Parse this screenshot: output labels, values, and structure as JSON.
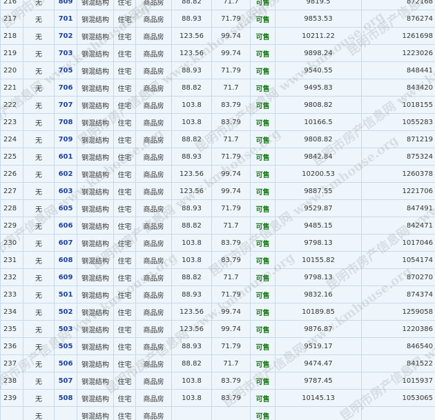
{
  "watermark_text": "昆明市房产信息网 www.kmhouse.org",
  "rows": [
    {
      "seq": "216",
      "mortgage": "无",
      "room": "809",
      "structure": "钢混结构",
      "usage": "住宅",
      "type": "商品房",
      "build_area": "88.82",
      "inner_area": "71.7",
      "status": "可售",
      "unit_price": "9819.5",
      "total_price": "872168"
    },
    {
      "seq": "217",
      "mortgage": "无",
      "room": "701",
      "structure": "钢混结构",
      "usage": "住宅",
      "type": "商品房",
      "build_area": "88.93",
      "inner_area": "71.79",
      "status": "可售",
      "unit_price": "9853.53",
      "total_price": "876274"
    },
    {
      "seq": "218",
      "mortgage": "无",
      "room": "702",
      "structure": "钢混结构",
      "usage": "住宅",
      "type": "商品房",
      "build_area": "123.56",
      "inner_area": "99.74",
      "status": "可售",
      "unit_price": "10211.22",
      "total_price": "1261698"
    },
    {
      "seq": "219",
      "mortgage": "无",
      "room": "703",
      "structure": "钢混结构",
      "usage": "住宅",
      "type": "商品房",
      "build_area": "123.56",
      "inner_area": "99.74",
      "status": "可售",
      "unit_price": "9898.24",
      "total_price": "1223026"
    },
    {
      "seq": "220",
      "mortgage": "无",
      "room": "705",
      "structure": "钢混结构",
      "usage": "住宅",
      "type": "商品房",
      "build_area": "88.93",
      "inner_area": "71.79",
      "status": "可售",
      "unit_price": "9540.55",
      "total_price": "848441"
    },
    {
      "seq": "221",
      "mortgage": "无",
      "room": "706",
      "structure": "钢混结构",
      "usage": "住宅",
      "type": "商品房",
      "build_area": "88.82",
      "inner_area": "71.7",
      "status": "可售",
      "unit_price": "9495.83",
      "total_price": "843420"
    },
    {
      "seq": "222",
      "mortgage": "无",
      "room": "707",
      "structure": "钢混结构",
      "usage": "住宅",
      "type": "商品房",
      "build_area": "103.8",
      "inner_area": "83.79",
      "status": "可售",
      "unit_price": "9808.82",
      "total_price": "1018155"
    },
    {
      "seq": "223",
      "mortgage": "无",
      "room": "708",
      "structure": "钢混结构",
      "usage": "住宅",
      "type": "商品房",
      "build_area": "103.8",
      "inner_area": "83.79",
      "status": "可售",
      "unit_price": "10166.5",
      "total_price": "1055283"
    },
    {
      "seq": "224",
      "mortgage": "无",
      "room": "709",
      "structure": "钢混结构",
      "usage": "住宅",
      "type": "商品房",
      "build_area": "88.82",
      "inner_area": "71.7",
      "status": "可售",
      "unit_price": "9808.82",
      "total_price": "871219"
    },
    {
      "seq": "225",
      "mortgage": "无",
      "room": "601",
      "structure": "钢混结构",
      "usage": "住宅",
      "type": "商品房",
      "build_area": "88.93",
      "inner_area": "71.79",
      "status": "可售",
      "unit_price": "9842.84",
      "total_price": "875324"
    },
    {
      "seq": "226",
      "mortgage": "无",
      "room": "602",
      "structure": "钢混结构",
      "usage": "住宅",
      "type": "商品房",
      "build_area": "123.56",
      "inner_area": "99.74",
      "status": "可售",
      "unit_price": "10200.53",
      "total_price": "1260378"
    },
    {
      "seq": "227",
      "mortgage": "无",
      "room": "603",
      "structure": "钢混结构",
      "usage": "住宅",
      "type": "商品房",
      "build_area": "123.56",
      "inner_area": "99.74",
      "status": "可售",
      "unit_price": "9887.55",
      "total_price": "1221706"
    },
    {
      "seq": "228",
      "mortgage": "无",
      "room": "605",
      "structure": "钢混结构",
      "usage": "住宅",
      "type": "商品房",
      "build_area": "88.93",
      "inner_area": "71.79",
      "status": "可售",
      "unit_price": "9529.87",
      "total_price": "847491"
    },
    {
      "seq": "229",
      "mortgage": "无",
      "room": "606",
      "structure": "钢混结构",
      "usage": "住宅",
      "type": "商品房",
      "build_area": "88.82",
      "inner_area": "71.7",
      "status": "可售",
      "unit_price": "9485.15",
      "total_price": "842471"
    },
    {
      "seq": "230",
      "mortgage": "无",
      "room": "607",
      "structure": "钢混结构",
      "usage": "住宅",
      "type": "商品房",
      "build_area": "103.8",
      "inner_area": "83.79",
      "status": "可售",
      "unit_price": "9798.13",
      "total_price": "1017046"
    },
    {
      "seq": "231",
      "mortgage": "无",
      "room": "608",
      "structure": "钢混结构",
      "usage": "住宅",
      "type": "商品房",
      "build_area": "103.8",
      "inner_area": "83.79",
      "status": "可售",
      "unit_price": "10155.82",
      "total_price": "1054174"
    },
    {
      "seq": "232",
      "mortgage": "无",
      "room": "609",
      "structure": "钢混结构",
      "usage": "住宅",
      "type": "商品房",
      "build_area": "88.82",
      "inner_area": "71.7",
      "status": "可售",
      "unit_price": "9798.13",
      "total_price": "870270"
    },
    {
      "seq": "233",
      "mortgage": "无",
      "room": "501",
      "structure": "钢混结构",
      "usage": "住宅",
      "type": "商品房",
      "build_area": "88.93",
      "inner_area": "71.79",
      "status": "可售",
      "unit_price": "9832.16",
      "total_price": "874374"
    },
    {
      "seq": "234",
      "mortgage": "无",
      "room": "502",
      "structure": "钢混结构",
      "usage": "住宅",
      "type": "商品房",
      "build_area": "123.56",
      "inner_area": "99.74",
      "status": "可售",
      "unit_price": "10189.85",
      "total_price": "1259058"
    },
    {
      "seq": "235",
      "mortgage": "无",
      "room": "503",
      "structure": "钢混结构",
      "usage": "住宅",
      "type": "商品房",
      "build_area": "123.56",
      "inner_area": "99.74",
      "status": "可售",
      "unit_price": "9876.87",
      "total_price": "1220386"
    },
    {
      "seq": "236",
      "mortgage": "无",
      "room": "505",
      "structure": "钢混结构",
      "usage": "住宅",
      "type": "商品房",
      "build_area": "88.93",
      "inner_area": "71.79",
      "status": "可售",
      "unit_price": "9519.17",
      "total_price": "846540"
    },
    {
      "seq": "237",
      "mortgage": "无",
      "room": "506",
      "structure": "钢混结构",
      "usage": "住宅",
      "type": "商品房",
      "build_area": "88.82",
      "inner_area": "71.7",
      "status": "可售",
      "unit_price": "9474.47",
      "total_price": "841522"
    },
    {
      "seq": "238",
      "mortgage": "无",
      "room": "507",
      "structure": "钢混结构",
      "usage": "住宅",
      "type": "商品房",
      "build_area": "103.8",
      "inner_area": "83.79",
      "status": "可售",
      "unit_price": "9787.45",
      "total_price": "1015937"
    },
    {
      "seq": "239",
      "mortgage": "无",
      "room": "508",
      "structure": "钢混结构",
      "usage": "住宅",
      "type": "商品房",
      "build_area": "103.8",
      "inner_area": "83.79",
      "status": "可售",
      "unit_price": "10145.13",
      "total_price": "1053065"
    },
    {
      "seq": "",
      "mortgage": "无",
      "room": "",
      "structure": "钢混结构",
      "usage": "住宅",
      "type": "商品房",
      "build_area": "",
      "inner_area": "",
      "status": "可售",
      "unit_price": "",
      "total_price": ""
    }
  ]
}
